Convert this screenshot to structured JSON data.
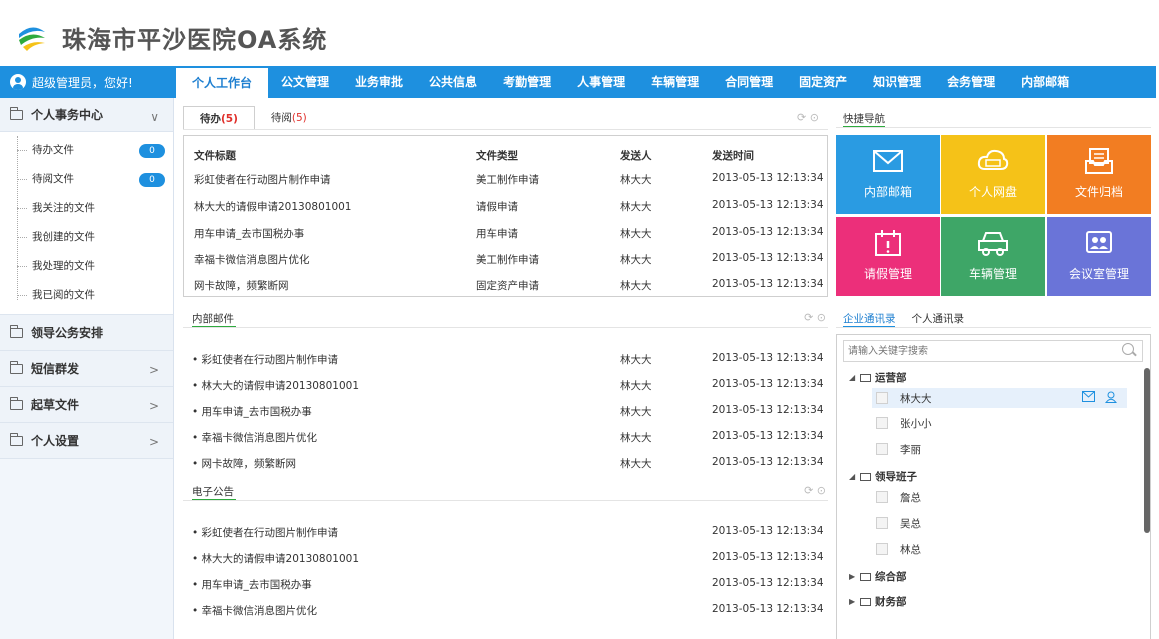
{
  "app": {
    "title": "珠海市平沙医院OA系统"
  },
  "user": {
    "greeting": "超级管理员，您好!"
  },
  "nav": {
    "tabs": [
      "个人工作台",
      "公文管理",
      "业务审批",
      "公共信息",
      "考勤管理",
      "人事管理",
      "车辆管理",
      "合同管理",
      "固定资产",
      "知识管理",
      "会务管理",
      "内部邮箱"
    ],
    "active_index": 0
  },
  "sidebar": {
    "personal": {
      "label": "个人事务中心",
      "items": [
        {
          "label": "待办文件",
          "count": "0"
        },
        {
          "label": "待阅文件",
          "count": "0"
        },
        {
          "label": "我关注的文件"
        },
        {
          "label": "我创建的文件"
        },
        {
          "label": "我处理的文件"
        },
        {
          "label": "我已阅的文件"
        }
      ]
    },
    "groups": [
      "领导公务安排",
      "短信群发",
      "起草文件",
      "个人设置"
    ]
  },
  "todo": {
    "tab_todo": "待办",
    "tab_todo_count": "(5)",
    "tab_read": "待阅",
    "tab_read_count": "(5)",
    "headers": [
      "文件标题",
      "文件类型",
      "发送人",
      "发送时间"
    ],
    "rows": [
      [
        "彩虹使者在行动图片制作申请",
        "美工制作申请",
        "林大大",
        "2013-05-13 12:13:34"
      ],
      [
        "林大大的请假申请20130801001",
        "请假申请",
        "林大大",
        "2013-05-13 12:13:34"
      ],
      [
        "用车申请_去市国税办事",
        "用车申请",
        "林大大",
        "2013-05-13 12:13:34"
      ],
      [
        "幸福卡微信消息图片优化",
        "美工制作申请",
        "林大大",
        "2013-05-13 12:13:34"
      ],
      [
        "网卡故障，频繁断网",
        "固定资产申请",
        "林大大",
        "2013-05-13 12:13:34"
      ]
    ]
  },
  "mail": {
    "title": "内部邮件",
    "rows": [
      [
        "• 彩虹使者在行动图片制作申请",
        "林大大",
        "2013-05-13 12:13:34"
      ],
      [
        "• 林大大的请假申请20130801001",
        "林大大",
        "2013-05-13 12:13:34"
      ],
      [
        "• 用车申请_去市国税办事",
        "林大大",
        "2013-05-13 12:13:34"
      ],
      [
        "• 幸福卡微信消息图片优化",
        "林大大",
        "2013-05-13 12:13:34"
      ],
      [
        "• 网卡故障，频繁断网",
        "林大大",
        "2013-05-13 12:13:34"
      ]
    ]
  },
  "notice": {
    "title": "电子公告",
    "rows": [
      [
        "• 彩虹使者在行动图片制作申请",
        "2013-05-13 12:13:34"
      ],
      [
        "• 林大大的请假申请20130801001",
        "2013-05-13 12:13:34"
      ],
      [
        "• 用车申请_去市国税办事",
        "2013-05-13 12:13:34"
      ],
      [
        "• 幸福卡微信消息图片优化",
        "2013-05-13 12:13:34"
      ]
    ]
  },
  "quick": {
    "title": "快捷导航",
    "tiles": [
      {
        "label": "内部邮箱",
        "color": "#2a9be2",
        "icon": "mail-icon"
      },
      {
        "label": "个人网盘",
        "color": "#f5c218",
        "icon": "cloud-disk-icon"
      },
      {
        "label": "文件归档",
        "color": "#f27d22",
        "icon": "archive-icon"
      },
      {
        "label": "请假管理",
        "color": "#ec2f7a",
        "icon": "calendar-icon"
      },
      {
        "label": "车辆管理",
        "color": "#3ea667",
        "icon": "car-icon"
      },
      {
        "label": "会议室管理",
        "color": "#6a74d8",
        "icon": "meeting-room-icon"
      }
    ]
  },
  "contacts": {
    "tab_company": "企业通讯录",
    "tab_personal": "个人通讯录",
    "search_placeholder": "请输入关键字搜索",
    "depts": [
      {
        "name": "运营部",
        "expanded": true,
        "people": [
          "林大大",
          "张小小",
          "李丽"
        ]
      },
      {
        "name": "领导班子",
        "expanded": true,
        "people": [
          "詹总",
          "吴总",
          "林总"
        ]
      },
      {
        "name": "综合部",
        "expanded": false,
        "people": []
      },
      {
        "name": "财务部",
        "expanded": false,
        "people": []
      }
    ]
  }
}
